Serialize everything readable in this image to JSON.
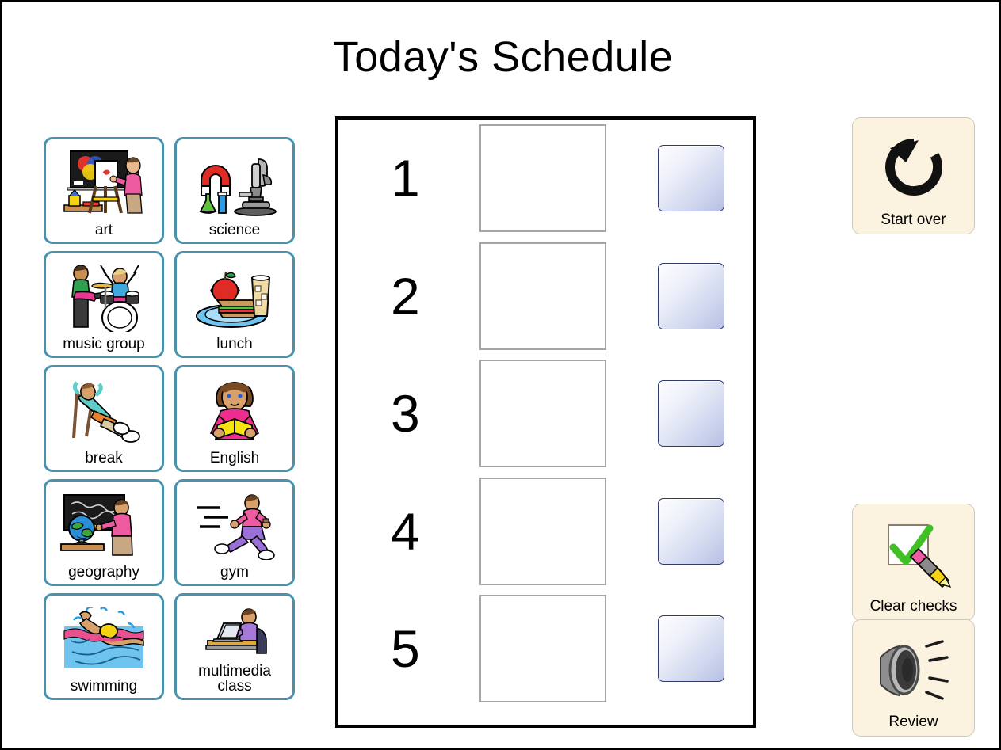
{
  "page": {
    "title": "Today's Schedule"
  },
  "activity_cards": [
    {
      "label": "art",
      "icon": "art-easel-icon"
    },
    {
      "label": "science",
      "icon": "microscope-magnet-icon"
    },
    {
      "label": "music group",
      "icon": "band-drums-guitar-icon"
    },
    {
      "label": "lunch",
      "icon": "sandwich-apple-drink-icon"
    },
    {
      "label": "break",
      "icon": "person-relaxing-chair-icon"
    },
    {
      "label": "English",
      "icon": "person-reading-book-icon"
    },
    {
      "label": "geography",
      "icon": "globe-world-map-icon"
    },
    {
      "label": "gym",
      "icon": "person-running-icon"
    },
    {
      "label": "swimming",
      "icon": "person-swimming-icon"
    },
    {
      "label": "multimedia class",
      "icon": "person-laptop-icon"
    }
  ],
  "schedule": {
    "rows": [
      {
        "number": "1",
        "slot_content": "",
        "checked": false
      },
      {
        "number": "2",
        "slot_content": "",
        "checked": false
      },
      {
        "number": "3",
        "slot_content": "",
        "checked": false
      },
      {
        "number": "4",
        "slot_content": "",
        "checked": false
      },
      {
        "number": "5",
        "slot_content": "",
        "checked": false
      }
    ]
  },
  "actions": {
    "start_over": {
      "label": "Start over",
      "icon": "circular-refresh-arrow-icon"
    },
    "clear_checks": {
      "label": "Clear checks",
      "icon": "checkmark-eraser-pencil-icon"
    },
    "review": {
      "label": "Review",
      "icon": "loudspeaker-sound-icon"
    }
  },
  "colors": {
    "card_border": "#4a92ab",
    "panel_border": "#000000",
    "slot_border": "#a6a6a6",
    "checkbox_border": "#32396b",
    "checkbox_gradient_start": "#fdfdff",
    "checkbox_gradient_end": "#b7c0e4",
    "action_button_bg": "#fbf2df",
    "page_bg": "#ffffff"
  }
}
